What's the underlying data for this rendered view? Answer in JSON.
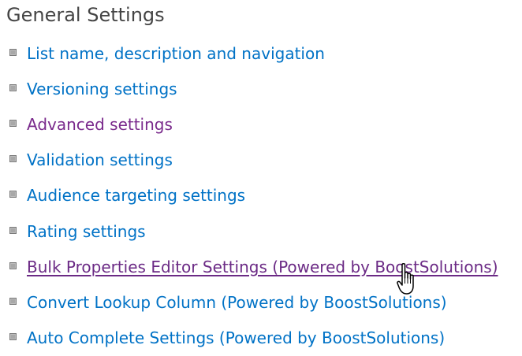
{
  "section": {
    "title": "General Settings"
  },
  "settings": [
    {
      "label": "List name, description and navigation",
      "state": "normal"
    },
    {
      "label": "Versioning settings",
      "state": "normal"
    },
    {
      "label": "Advanced settings",
      "state": "visited"
    },
    {
      "label": "Validation settings",
      "state": "normal"
    },
    {
      "label": "Audience targeting settings",
      "state": "normal"
    },
    {
      "label": "Rating settings",
      "state": "normal"
    },
    {
      "label": "Bulk Properties Editor Settings (Powered by BoostSolutions)",
      "state": "hovered"
    },
    {
      "label": "Convert Lookup Column (Powered by BoostSolutions)",
      "state": "normal"
    },
    {
      "label": "Auto Complete Settings (Powered by BoostSolutions)",
      "state": "normal"
    }
  ],
  "colors": {
    "link": "#0072c6",
    "visited_link": "#7a2a8c",
    "title": "#444444"
  },
  "icons": {
    "bullet": "square-bullet-icon",
    "cursor": "hand-pointer-icon"
  }
}
